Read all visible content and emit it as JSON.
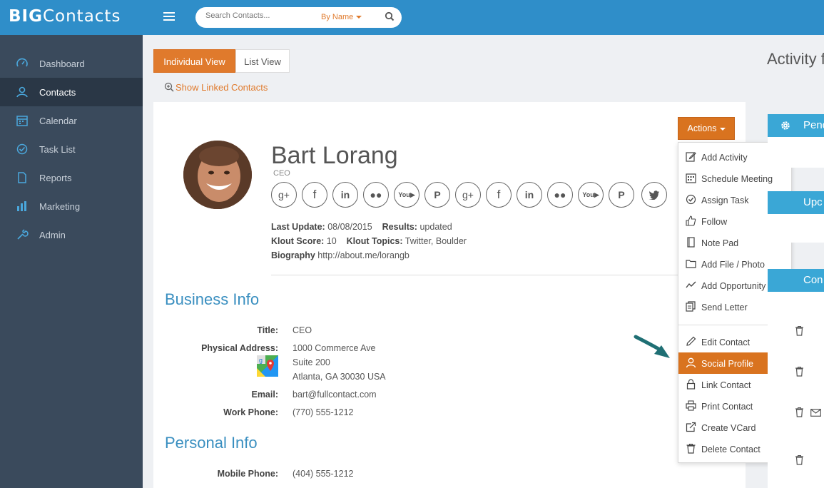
{
  "app": {
    "logo_bold": "BIG",
    "logo_rest": "Contacts"
  },
  "search": {
    "placeholder": "Search Contacts...",
    "mode": "By Name"
  },
  "sidebar": {
    "items": [
      {
        "label": "Dashboard",
        "icon": "dashboard-icon"
      },
      {
        "label": "Contacts",
        "icon": "user-icon",
        "active": true
      },
      {
        "label": "Calendar",
        "icon": "calendar-icon"
      },
      {
        "label": "Task List",
        "icon": "check-circle-icon"
      },
      {
        "label": "Reports",
        "icon": "document-icon"
      },
      {
        "label": "Marketing",
        "icon": "bar-chart-icon"
      },
      {
        "label": "Admin",
        "icon": "wrench-icon"
      }
    ]
  },
  "views": {
    "individual": "Individual View",
    "list": "List View"
  },
  "linked": "Show Linked Contacts",
  "contact": {
    "name": "Bart Lorang",
    "title": "CEO",
    "last_update_label": "Last Update:",
    "last_update": "08/08/2015",
    "results_label": "Results:",
    "results": "updated",
    "klout_score_label": "Klout Score:",
    "klout_score": "10",
    "klout_topics_label": "Klout Topics:",
    "klout_topics": "Twitter, Boulder",
    "bio_label": "Biography",
    "bio": "http://about.me/lorangb"
  },
  "socials": [
    "google-plus",
    "facebook",
    "linkedin",
    "flickr",
    "youtube",
    "pinterest",
    "google-plus",
    "facebook",
    "linkedin",
    "flickr",
    "youtube",
    "pinterest",
    "twitter"
  ],
  "business": {
    "heading": "Business Info",
    "title_label": "Title:",
    "title": "CEO",
    "address_label": "Physical Address:",
    "address_1": "1000 Commerce Ave",
    "address_2": "Suite 200",
    "address_3": "Atlanta, GA 30030 USA",
    "email_label": "Email:",
    "email": "bart@fullcontact.com",
    "work_phone_label": "Work Phone:",
    "work_phone": "(770) 555-1212"
  },
  "personal": {
    "heading": "Personal Info",
    "mobile_label": "Mobile Phone:",
    "mobile": "(404) 555-1212"
  },
  "actions": {
    "button": "Actions",
    "items": [
      "Add Activity",
      "Schedule Meeting",
      "Assign Task",
      "Follow",
      "Note Pad",
      "Add File / Photo",
      "Add Opportunity",
      "Send Letter",
      "Edit Contact",
      "Social Profile",
      "Link Contact",
      "Print Contact",
      "Create VCard",
      "Delete Contact"
    ],
    "highlighted": "Social Profile"
  },
  "right": {
    "activity_title": "Activity f",
    "panel_pending": "Pend",
    "panel_upcoming": "Upc",
    "panel_con": "Con"
  },
  "colors": {
    "accent": "#d9731f",
    "topbar": "#2f8ec9",
    "sidebar": "#3a4a5c",
    "link_blue": "#3a8fc0"
  }
}
